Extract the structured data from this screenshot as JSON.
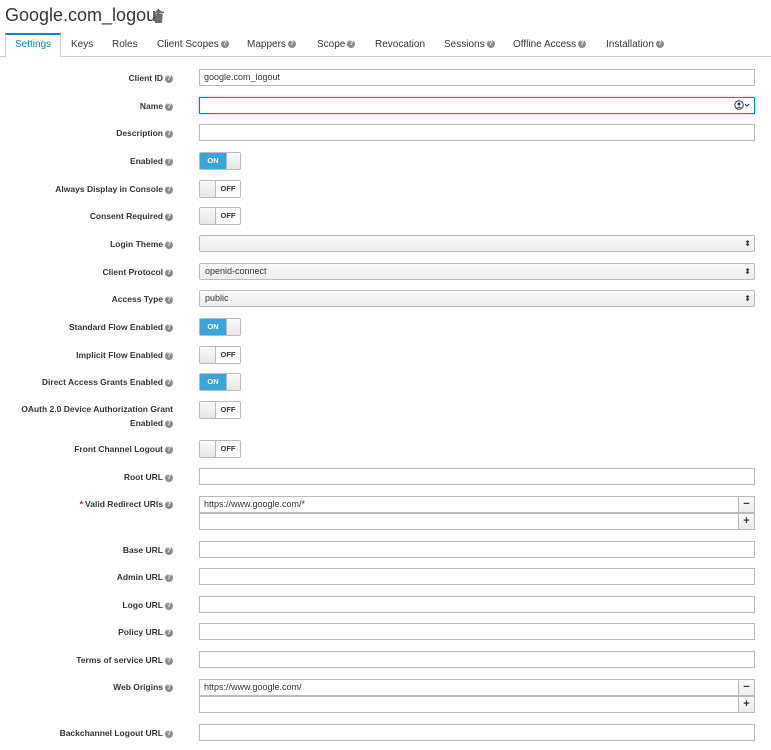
{
  "header": {
    "title": "Google.com_logout"
  },
  "tabs": [
    {
      "label": "Settings"
    },
    {
      "label": "Keys"
    },
    {
      "label": "Roles"
    },
    {
      "label": "Client Scopes"
    },
    {
      "label": "Mappers"
    },
    {
      "label": "Scope"
    },
    {
      "label": "Revocation"
    },
    {
      "label": "Sessions"
    },
    {
      "label": "Offline Access"
    },
    {
      "label": "Installation"
    }
  ],
  "form": {
    "client_id": {
      "label": "Client ID",
      "value": "google.com_logout"
    },
    "name": {
      "label": "Name",
      "value": ""
    },
    "description": {
      "label": "Description",
      "value": ""
    },
    "enabled": {
      "label": "Enabled",
      "state": "ON"
    },
    "always_display": {
      "label": "Always Display in Console",
      "state": "OFF"
    },
    "consent_required": {
      "label": "Consent Required",
      "state": "OFF"
    },
    "login_theme": {
      "label": "Login Theme",
      "value": ""
    },
    "client_protocol": {
      "label": "Client Protocol",
      "value": "openid-connect"
    },
    "access_type": {
      "label": "Access Type",
      "value": "public"
    },
    "standard_flow": {
      "label": "Standard Flow Enabled",
      "state": "ON"
    },
    "implicit_flow": {
      "label": "Implicit Flow Enabled",
      "state": "OFF"
    },
    "direct_access": {
      "label": "Direct Access Grants Enabled",
      "state": "ON"
    },
    "device_grant": {
      "label_line1": "OAuth 2.0 Device Authorization Grant",
      "label_line2": "Enabled",
      "state": "OFF"
    },
    "front_channel": {
      "label": "Front Channel Logout",
      "state": "OFF"
    },
    "root_url": {
      "label": "Root URL",
      "value": ""
    },
    "valid_redirect": {
      "label": "Valid Redirect URIs",
      "required": "*",
      "values": [
        "https://www.google.com/*",
        ""
      ]
    },
    "base_url": {
      "label": "Base URL",
      "value": ""
    },
    "admin_url": {
      "label": "Admin URL",
      "value": ""
    },
    "logo_url": {
      "label": "Logo URL",
      "value": ""
    },
    "policy_url": {
      "label": "Policy URL",
      "value": ""
    },
    "tos_url": {
      "label": "Terms of service URL",
      "value": ""
    },
    "web_origins": {
      "label": "Web Origins",
      "values": [
        "https://www.google.com/",
        ""
      ]
    },
    "backchannel_logout": {
      "label": "Backchannel Logout URL",
      "value": ""
    }
  },
  "controls": {
    "help": "?",
    "remove": "−",
    "add": "+",
    "select_arrows": "⬍"
  },
  "colors": {
    "accent": "#0088ce",
    "toggle_on": "#39a5dc",
    "required": "#cc0000"
  }
}
